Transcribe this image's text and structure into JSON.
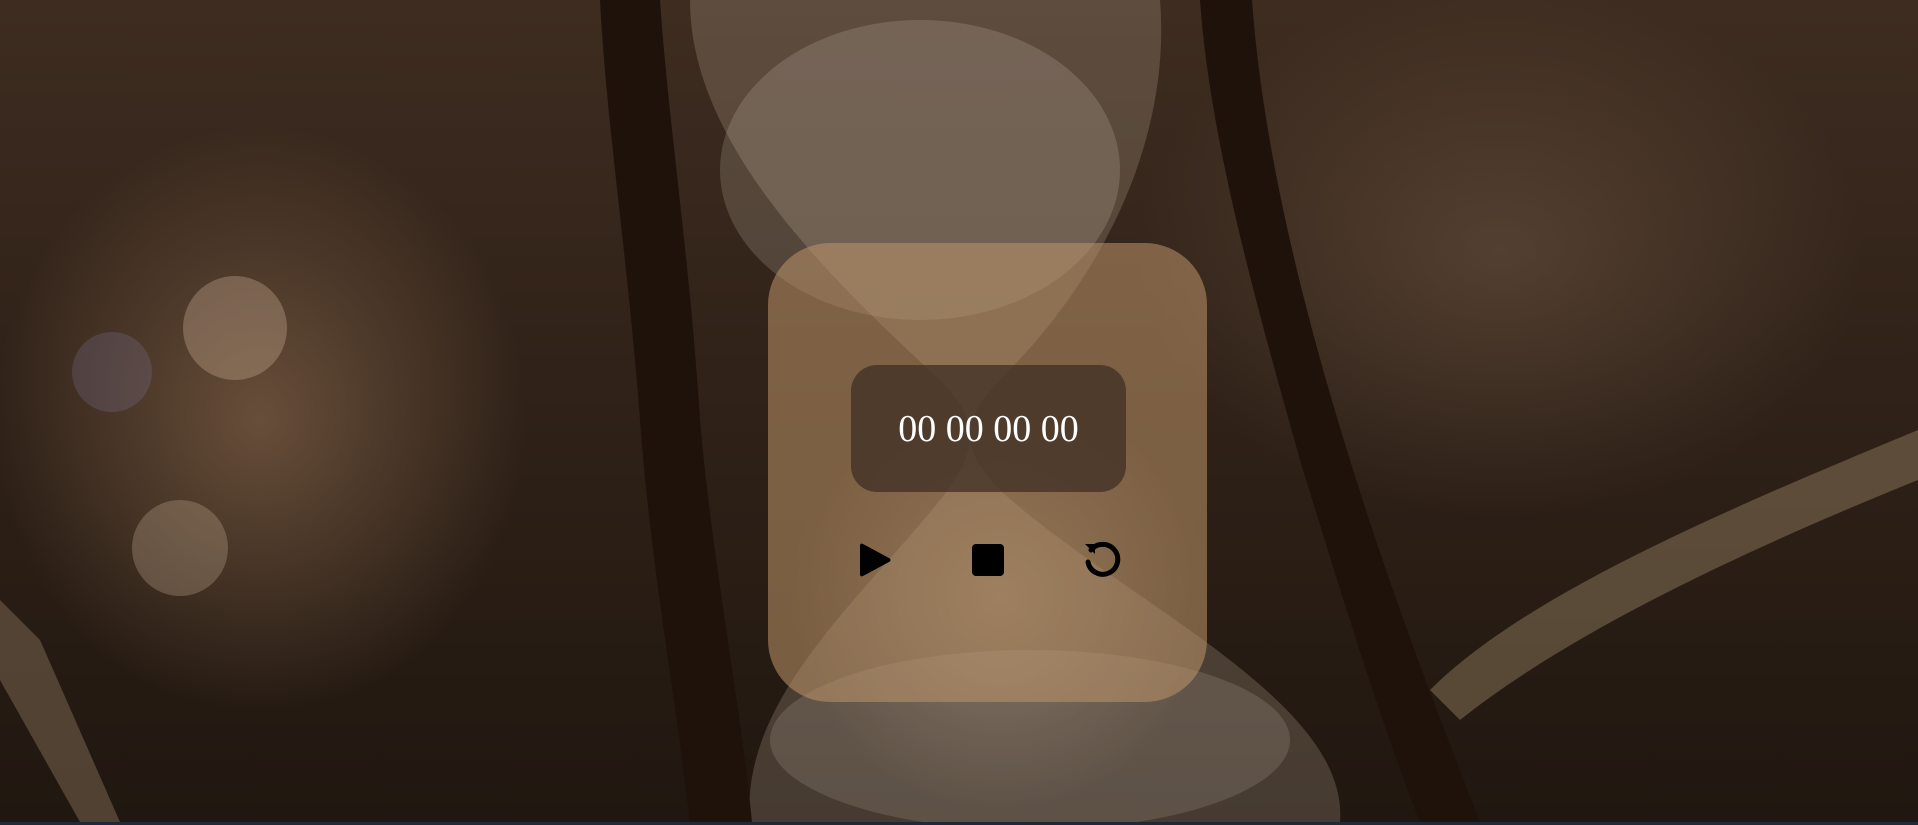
{
  "timer": {
    "display": "00 00 00 00"
  },
  "controls": {
    "play_icon": "play-icon",
    "stop_icon": "stop-icon",
    "reset_icon": "reset-icon"
  },
  "colors": {
    "card": "#be9669",
    "display_bg": "#3c2d23",
    "digits": "#ffffff",
    "icons": "#000000"
  }
}
